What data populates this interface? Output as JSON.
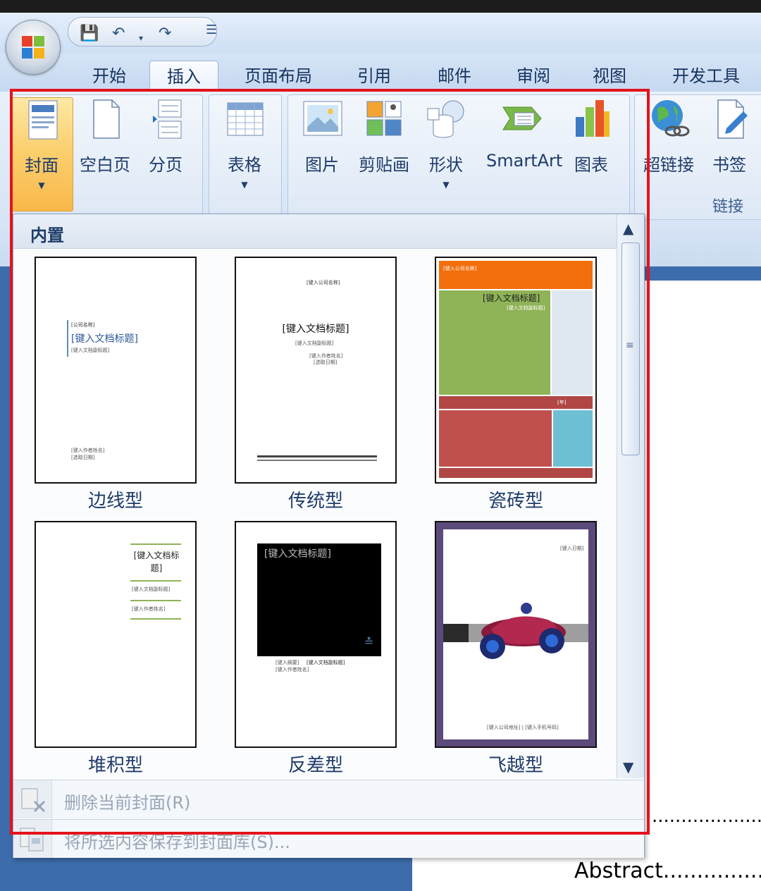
{
  "tabs": [
    "开始",
    "插入",
    "页面布局",
    "引用",
    "邮件",
    "审阅",
    "视图",
    "开发工具"
  ],
  "active_tab": "插入",
  "ribbon": {
    "cover": "封面",
    "blank_page": "空白页",
    "page_break": "分页",
    "table": "表格",
    "picture": "图片",
    "clipart": "剪贴画",
    "shapes": "形状",
    "smartart": "SmartArt",
    "chart": "图表",
    "hyperlink": "超链接",
    "bookmark": "书签",
    "links_group": "链接"
  },
  "gallery": {
    "header": "内置",
    "templates": [
      {
        "name": "边线型",
        "title": "[键入文档标题]"
      },
      {
        "name": "传统型",
        "title": "[键入文档标题]"
      },
      {
        "name": "瓷砖型",
        "title": "[键入文档标题]"
      },
      {
        "name": "堆积型",
        "title": "[键入文档标题]"
      },
      {
        "name": "反差型",
        "title": "[键入文档标题]"
      },
      {
        "name": "飞越型",
        "title": ""
      }
    ],
    "remove_cover": "删除当前封面(R)",
    "save_selection": "将所选内容保存到封面库(S)..."
  },
  "document": {
    "dots": "..........................",
    "abstract": "Abstract......................"
  },
  "colors": {
    "highlight": "#e5121b",
    "tile_orange": "#f26f0c",
    "tile_green": "#8fb357",
    "tile_red": "#c0504d",
    "tile_blue": "#6fbfd4"
  }
}
